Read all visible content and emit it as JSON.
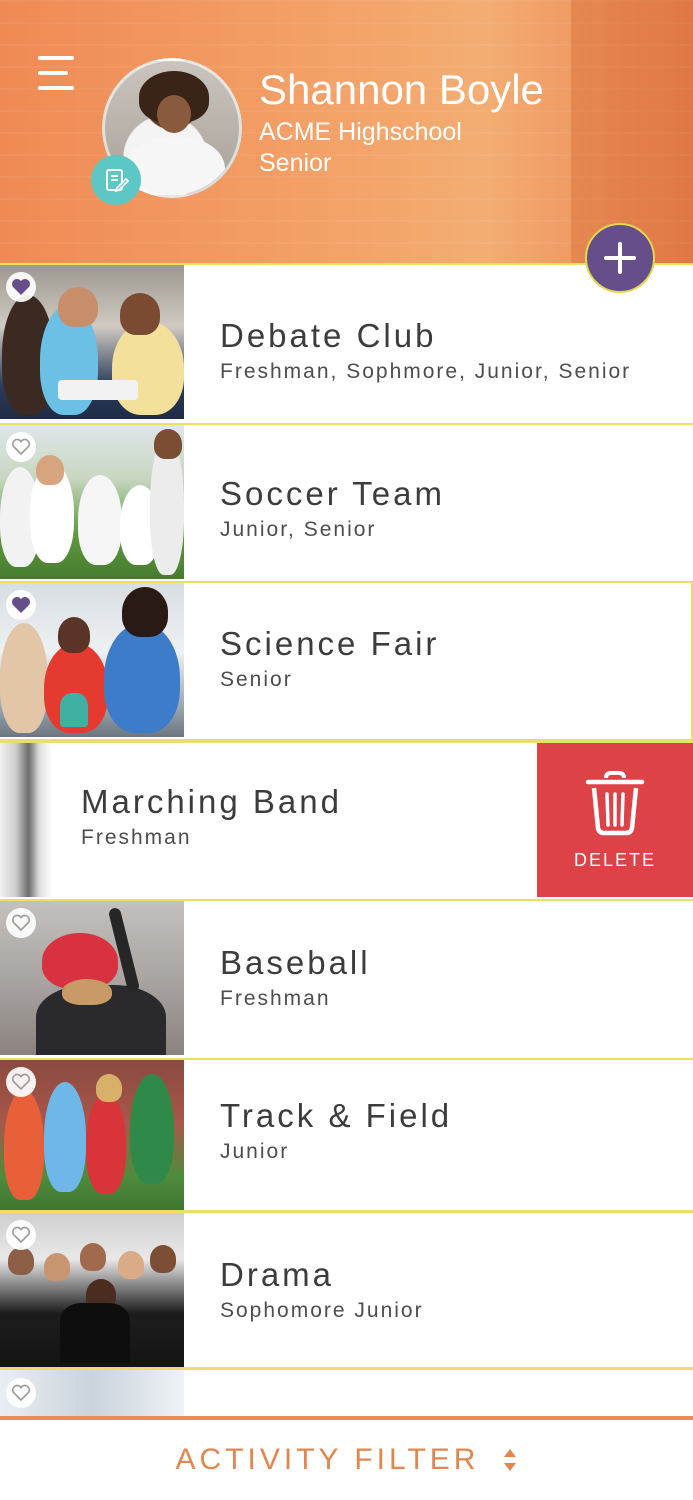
{
  "profile": {
    "name": "Shannon Boyle",
    "school": "ACME Highschool",
    "grade": "Senior"
  },
  "activities": [
    {
      "title": "Debate Club",
      "grades": "Freshman, Sophmore, Junior, Senior",
      "favorite": true
    },
    {
      "title": "Soccer Team",
      "grades": "Junior, Senior",
      "favorite": false
    },
    {
      "title": "Science Fair",
      "grades": "Senior",
      "favorite": true
    },
    {
      "title": "Marching Band",
      "grades": "Freshman",
      "favorite": false
    },
    {
      "title": "Baseball",
      "grades": "Freshman",
      "favorite": false
    },
    {
      "title": "Track & Field",
      "grades": "Junior",
      "favorite": false
    },
    {
      "title": "Drama",
      "grades": "Sophomore Junior",
      "favorite": false
    },
    {
      "title": "",
      "grades": "",
      "favorite": false
    }
  ],
  "delete_label": "DELETE",
  "filter": {
    "label": "ACTIVITY FILTER"
  },
  "colors": {
    "header": "#f0925a",
    "accent_purple": "#654e8a",
    "divider_yellow": "#ebdf62",
    "delete_red": "#dd4247",
    "filter_orange": "#e2864f",
    "edit_teal": "#5cc7c4"
  },
  "icons": {
    "menu": "hamburger-icon",
    "edit": "edit-note-icon",
    "add": "plus-icon",
    "favorite": "heart-icon",
    "delete": "trash-icon",
    "sort": "sort-arrows-icon"
  }
}
